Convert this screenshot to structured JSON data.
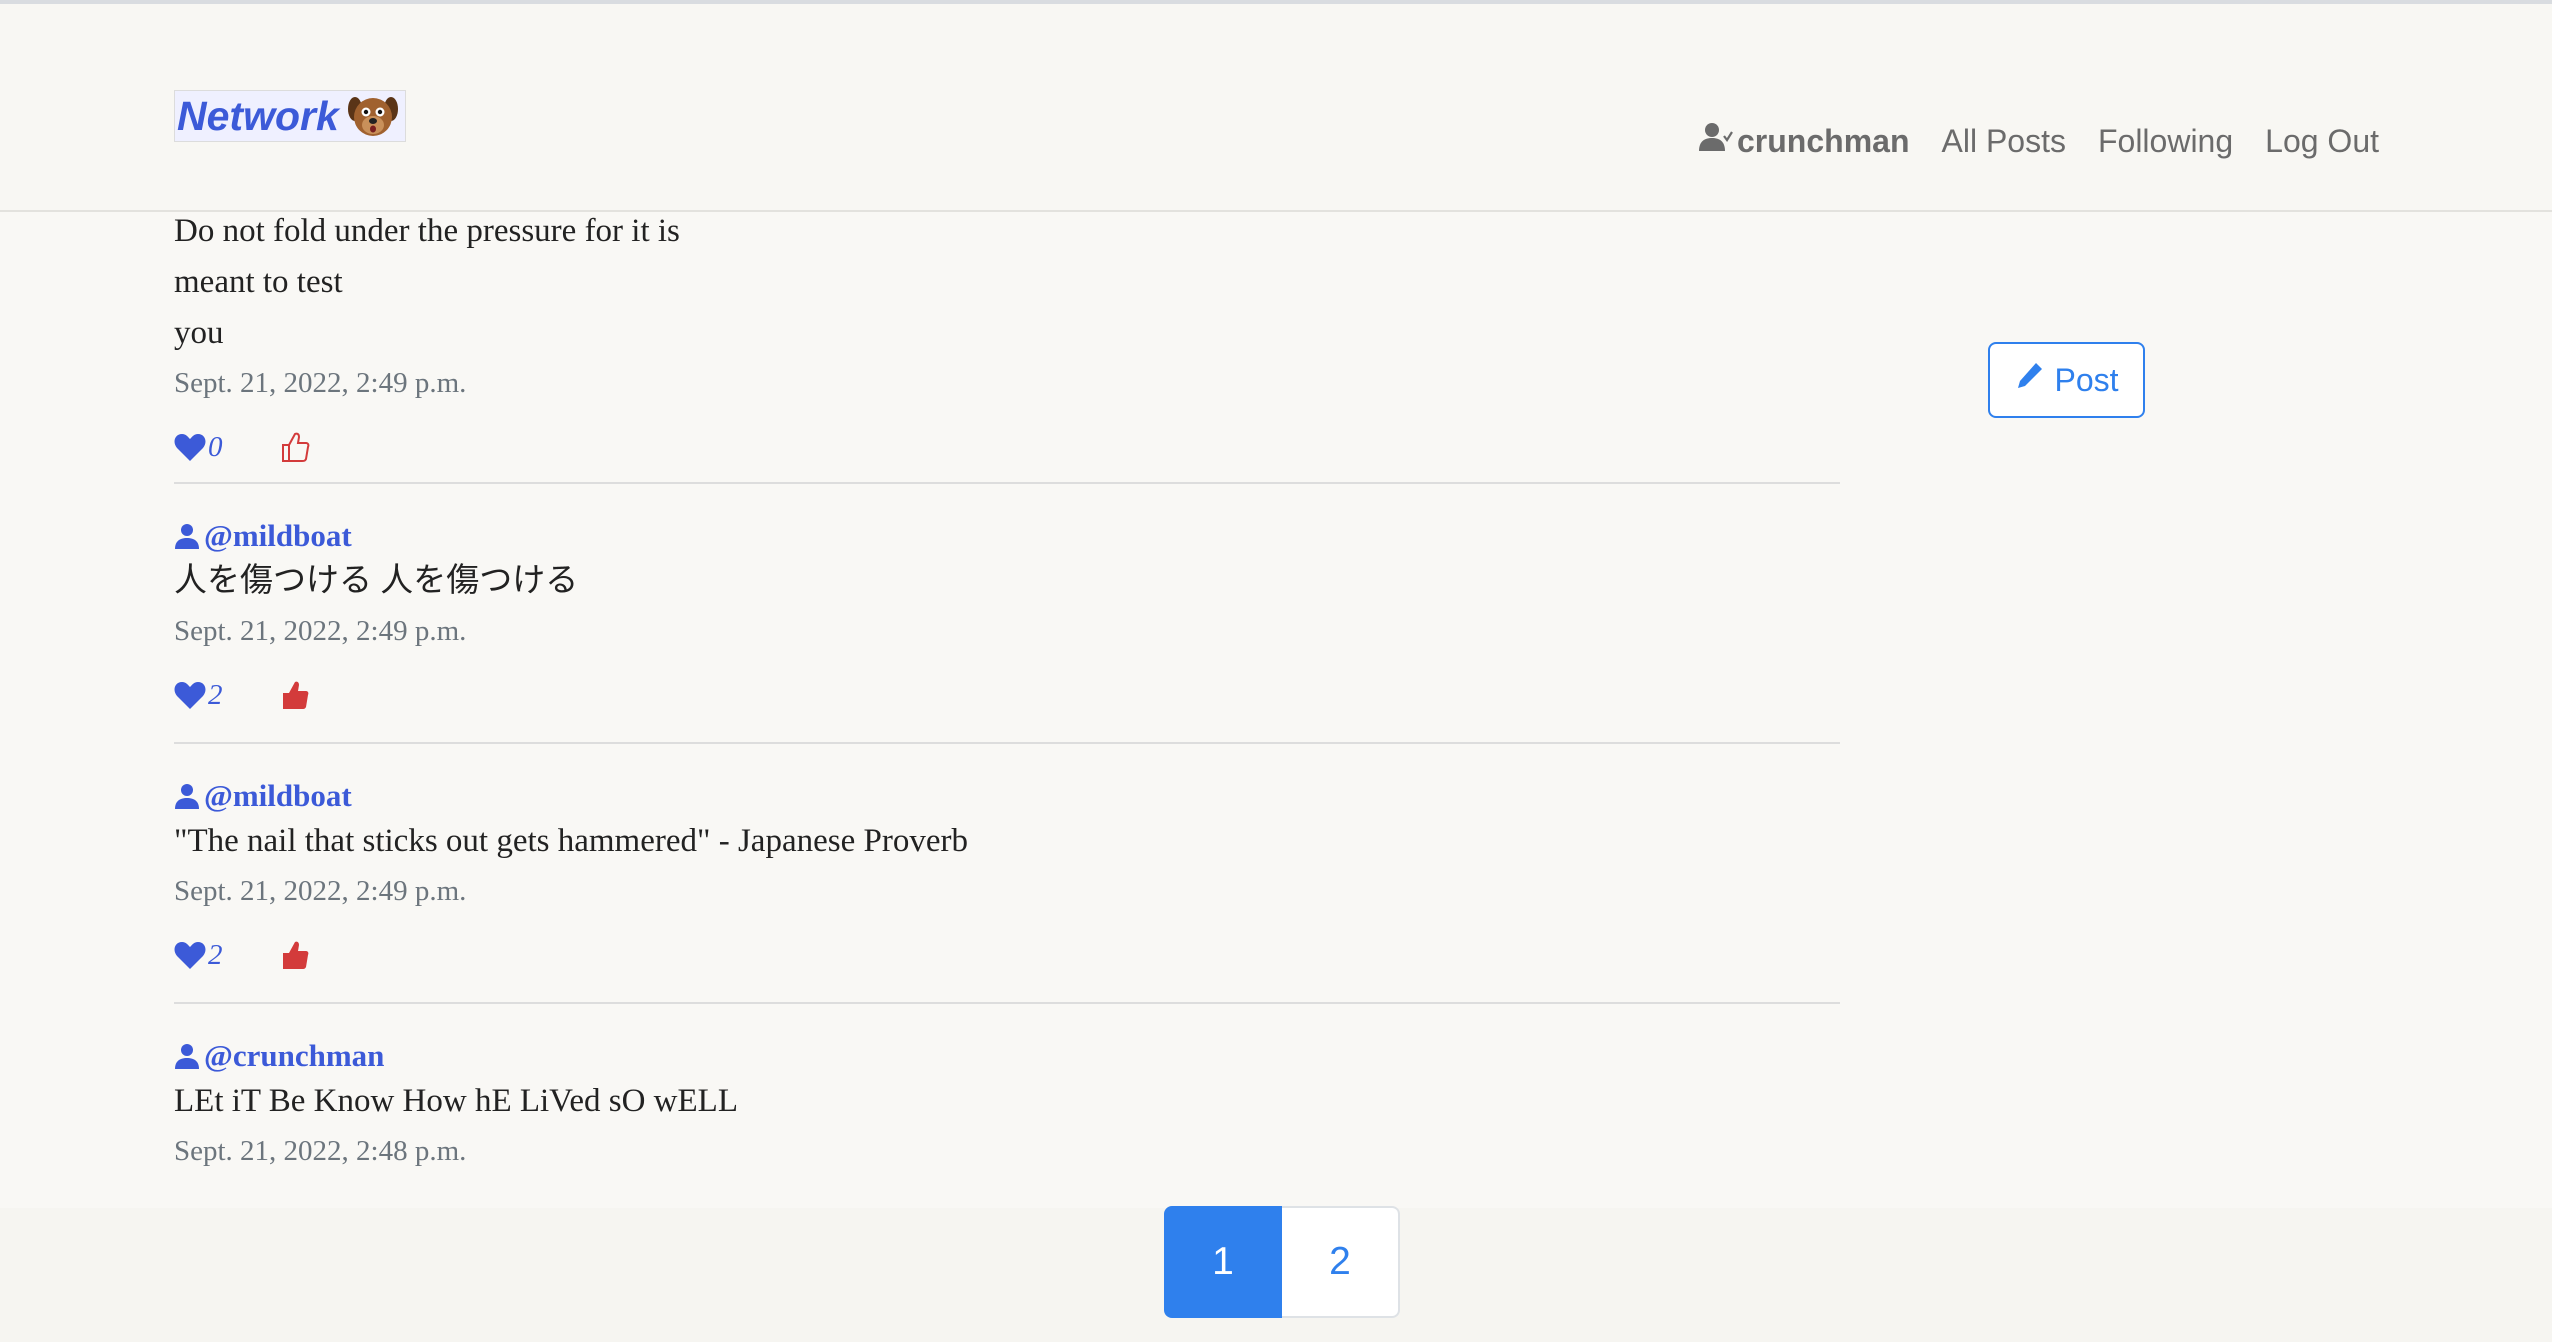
{
  "navbar": {
    "brand": "Network",
    "username": "crunchman",
    "links": [
      "All Posts",
      "Following",
      "Log Out"
    ]
  },
  "sidebar": {
    "post_button_label": "Post"
  },
  "posts": [
    {
      "author": "",
      "content_lines": [
        "Do not fold under the pressure for it is",
        "meant to test",
        "you"
      ],
      "date": "Sept. 21, 2022, 2:49 p.m.",
      "likes": "0",
      "liked_by_me": false
    },
    {
      "author": "@mildboat",
      "content_lines": [
        "人を傷つける 人を傷つける"
      ],
      "date": "Sept. 21, 2022, 2:49 p.m.",
      "likes": "2",
      "liked_by_me": true
    },
    {
      "author": "@mildboat",
      "content_lines": [
        "\"The nail that sticks out gets hammered\" - Japanese Proverb"
      ],
      "date": "Sept. 21, 2022, 2:49 p.m.",
      "likes": "2",
      "liked_by_me": true
    },
    {
      "author": "@crunchman",
      "content_lines": [
        "LEt iT Be Know How hE LiVed sO wELL"
      ],
      "date": "Sept. 21, 2022, 2:48 p.m.",
      "likes": "",
      "liked_by_me": false
    }
  ],
  "pagination": {
    "pages": [
      "1",
      "2"
    ],
    "current": "1"
  },
  "colors": {
    "accent": "#2f80ed",
    "brand": "#3c5ad8",
    "like_red": "#d33b3b"
  }
}
